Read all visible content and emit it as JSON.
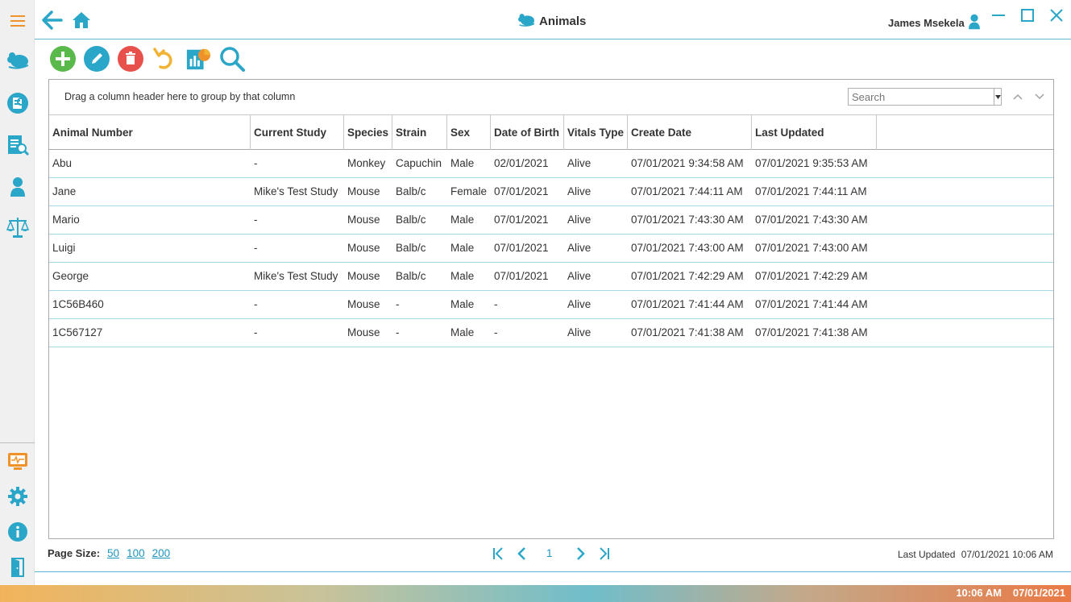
{
  "header": {
    "title": "Animals",
    "user_name": "James Msekela"
  },
  "grid": {
    "group_hint": "Drag a column header here to group by that column",
    "search_placeholder": "Search",
    "columns": [
      "Animal Number",
      "Current Study",
      "Species",
      "Strain",
      "Sex",
      "Date of Birth",
      "Vitals Type",
      "Create Date",
      "Last Updated"
    ],
    "rows": [
      [
        "Abu",
        "-",
        "Monkey",
        "Capuchin",
        "Male",
        "02/01/2021",
        "Alive",
        "07/01/2021 9:34:58 AM",
        "07/01/2021 9:35:53 AM"
      ],
      [
        "Jane",
        "Mike's Test Study",
        "Mouse",
        "Balb/c",
        "Female",
        "07/01/2021",
        "Alive",
        "07/01/2021 7:44:11 AM",
        "07/01/2021 7:44:11 AM"
      ],
      [
        "Mario",
        "-",
        "Mouse",
        "Balb/c",
        "Male",
        "07/01/2021",
        "Alive",
        "07/01/2021 7:43:30 AM",
        "07/01/2021 7:43:30 AM"
      ],
      [
        "Luigi",
        "-",
        "Mouse",
        "Balb/c",
        "Male",
        "07/01/2021",
        "Alive",
        "07/01/2021 7:43:00 AM",
        "07/01/2021 7:43:00 AM"
      ],
      [
        "George",
        "Mike's Test Study",
        "Mouse",
        "Balb/c",
        "Male",
        "07/01/2021",
        "Alive",
        "07/01/2021 7:42:29 AM",
        "07/01/2021 7:42:29 AM"
      ],
      [
        "1C56B460",
        "-",
        "Mouse",
        "-",
        "Male",
        "-",
        "Alive",
        "07/01/2021 7:41:44 AM",
        "07/01/2021 7:41:44 AM"
      ],
      [
        "1C567127",
        "-",
        "Mouse",
        "-",
        "Male",
        "-",
        "Alive",
        "07/01/2021 7:41:38 AM",
        "07/01/2021 7:41:38 AM"
      ]
    ]
  },
  "pager": {
    "page_size_label": "Page Size:",
    "page_sizes": [
      "50",
      "100",
      "200"
    ],
    "current_page": "1",
    "last_updated_label": "Last Updated",
    "last_updated_value": "07/01/2021 10:06 AM"
  },
  "status": {
    "time": "10:06 AM",
    "date": "07/01/2021"
  },
  "icons": {
    "menu": "hamburger-icon",
    "back": "arrow-left-icon",
    "home": "home-icon",
    "sidebar": [
      "mouse-icon",
      "study-icon",
      "report-search-icon",
      "user-icon",
      "scales-icon",
      "monitor-icon",
      "gear-icon",
      "info-icon",
      "exit-door-icon"
    ],
    "toolbar": [
      "add-icon",
      "edit-icon",
      "delete-icon",
      "undo-icon",
      "report-chart-icon",
      "search-icon"
    ]
  },
  "colors": {
    "accent": "#2aa6c9",
    "orange": "#f0922a",
    "add_green": "#59b94a",
    "delete_red": "#e8504c",
    "undo_yellow": "#f2b233"
  }
}
